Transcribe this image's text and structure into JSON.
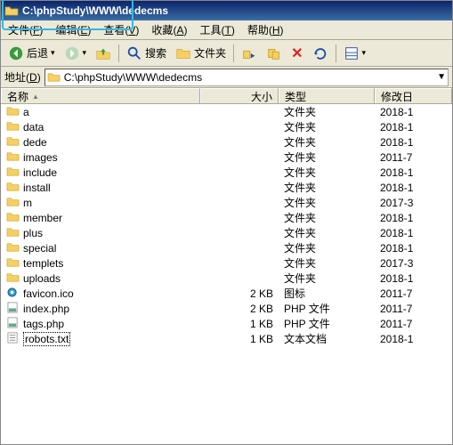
{
  "window": {
    "title": "C:\\phpStudy\\WWW\\dedecms"
  },
  "menubar": [
    {
      "label": "文件",
      "key": "F"
    },
    {
      "label": "编辑",
      "key": "E"
    },
    {
      "label": "查看",
      "key": "V"
    },
    {
      "label": "收藏",
      "key": "A"
    },
    {
      "label": "工具",
      "key": "T"
    },
    {
      "label": "帮助",
      "key": "H"
    }
  ],
  "toolbar": {
    "back": "后退",
    "search": "搜索",
    "folders": "文件夹"
  },
  "addressbar": {
    "label": "地址",
    "key": "D",
    "path": "C:\\phpStudy\\WWW\\dedecms"
  },
  "columns": {
    "name": "名称",
    "size": "大小",
    "type": "类型",
    "modified": "修改日"
  },
  "rows": [
    {
      "icon": "folder",
      "name": "a",
      "size": "",
      "type": "文件夹",
      "mod": "2018-1"
    },
    {
      "icon": "folder",
      "name": "data",
      "size": "",
      "type": "文件夹",
      "mod": "2018-1"
    },
    {
      "icon": "folder",
      "name": "dede",
      "size": "",
      "type": "文件夹",
      "mod": "2018-1"
    },
    {
      "icon": "folder",
      "name": "images",
      "size": "",
      "type": "文件夹",
      "mod": "2011-7"
    },
    {
      "icon": "folder",
      "name": "include",
      "size": "",
      "type": "文件夹",
      "mod": "2018-1"
    },
    {
      "icon": "folder",
      "name": "install",
      "size": "",
      "type": "文件夹",
      "mod": "2018-1"
    },
    {
      "icon": "folder",
      "name": "m",
      "size": "",
      "type": "文件夹",
      "mod": "2017-3"
    },
    {
      "icon": "folder",
      "name": "member",
      "size": "",
      "type": "文件夹",
      "mod": "2018-1"
    },
    {
      "icon": "folder",
      "name": "plus",
      "size": "",
      "type": "文件夹",
      "mod": "2018-1"
    },
    {
      "icon": "folder",
      "name": "special",
      "size": "",
      "type": "文件夹",
      "mod": "2018-1"
    },
    {
      "icon": "folder",
      "name": "templets",
      "size": "",
      "type": "文件夹",
      "mod": "2017-3"
    },
    {
      "icon": "folder",
      "name": "uploads",
      "size": "",
      "type": "文件夹",
      "mod": "2018-1"
    },
    {
      "icon": "ico",
      "name": "favicon.ico",
      "size": "2 KB",
      "type": "图标",
      "mod": "2011-7"
    },
    {
      "icon": "php",
      "name": "index.php",
      "size": "2 KB",
      "type": "PHP 文件",
      "mod": "2011-7"
    },
    {
      "icon": "php",
      "name": "tags.php",
      "size": "1 KB",
      "type": "PHP 文件",
      "mod": "2011-7"
    },
    {
      "icon": "txt",
      "name": "robots.txt",
      "size": "1 KB",
      "type": "文本文档",
      "mod": "2018-1"
    }
  ],
  "selection": {
    "start": 14,
    "focus": 15
  }
}
